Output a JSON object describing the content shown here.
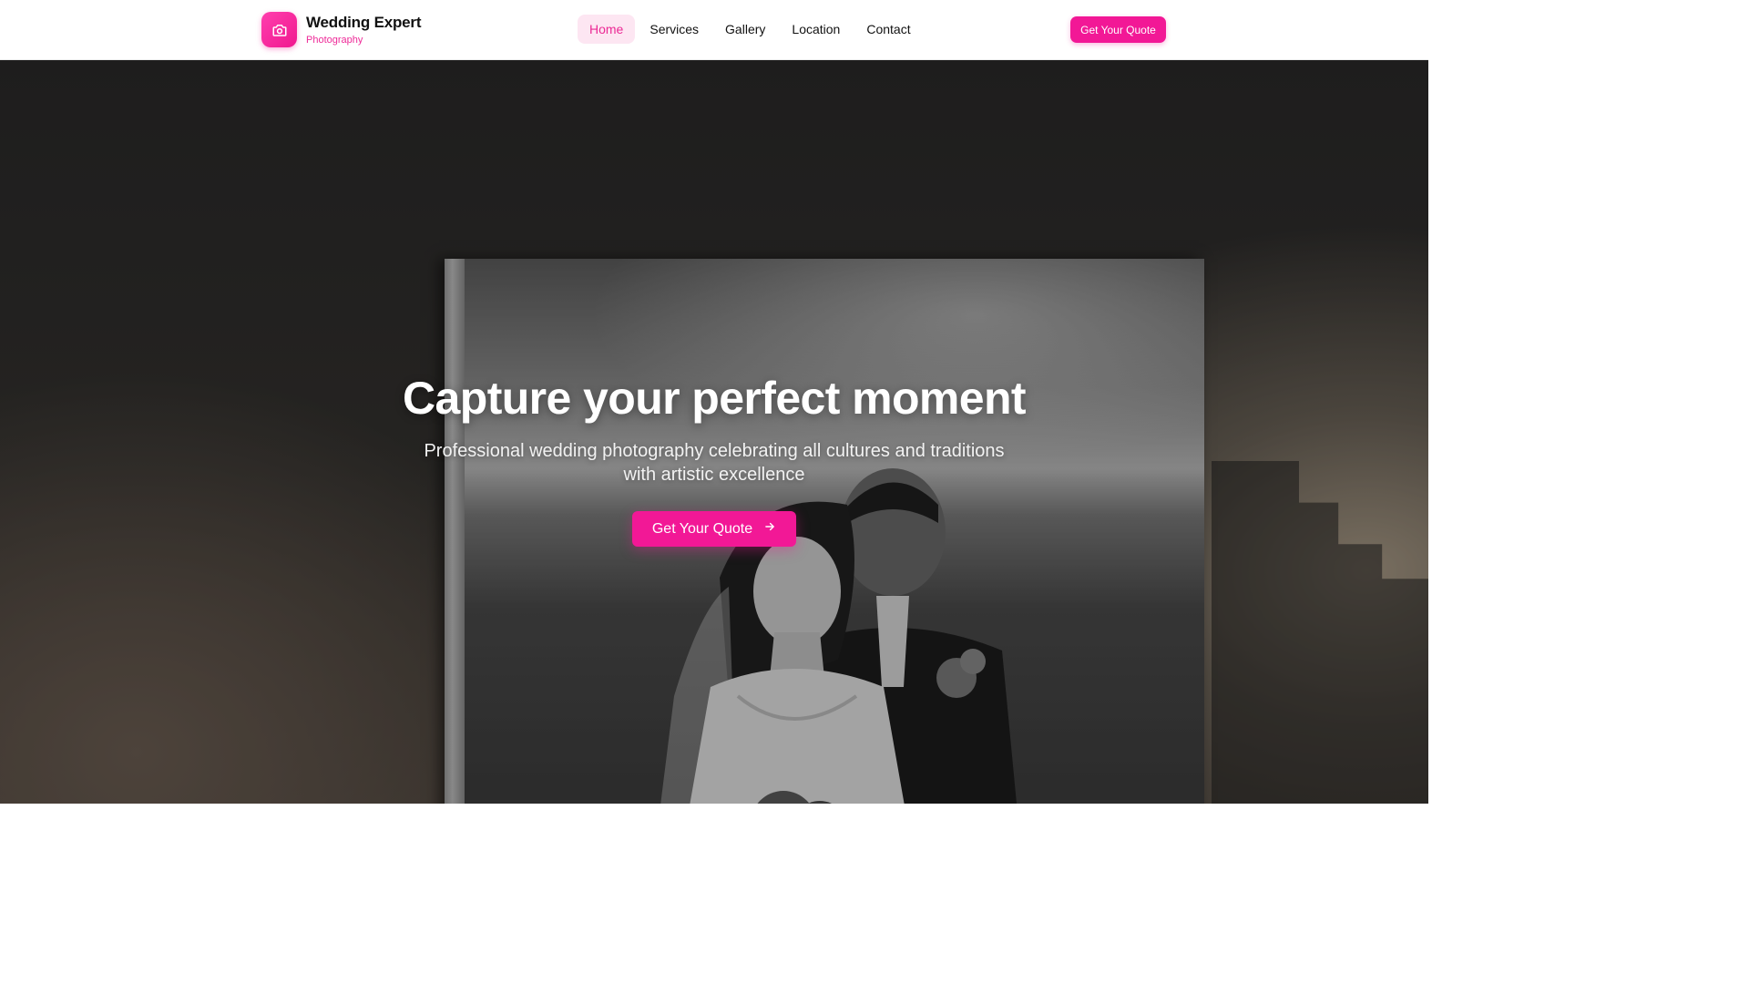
{
  "brand": {
    "name": "Wedding Expert",
    "tagline": "Photography",
    "logo_icon": "camera-icon",
    "accent_color": "#f21896"
  },
  "nav": {
    "items": [
      {
        "label": "Home",
        "active": true
      },
      {
        "label": "Services",
        "active": false
      },
      {
        "label": "Gallery",
        "active": false
      },
      {
        "label": "Location",
        "active": false
      },
      {
        "label": "Contact",
        "active": false
      }
    ]
  },
  "header": {
    "cta_label": "Get Your Quote"
  },
  "hero": {
    "title": "Capture your perfect moment",
    "subtitle": "Professional wedding photography celebrating all cultures and traditions with artistic excellence",
    "cta_label": "Get Your Quote",
    "cta_icon": "arrow-right-icon"
  }
}
